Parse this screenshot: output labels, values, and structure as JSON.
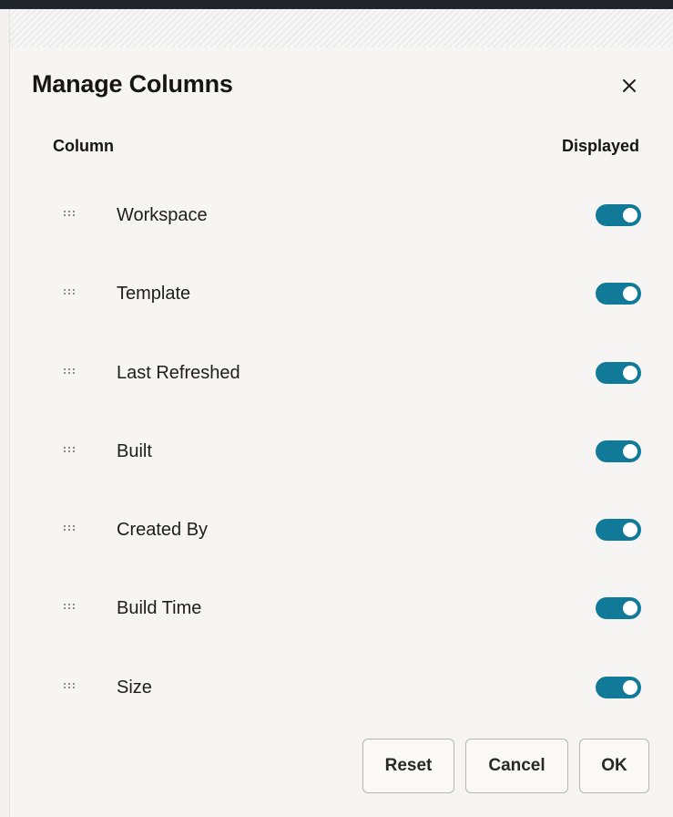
{
  "dialog": {
    "title": "Manage Columns",
    "close_icon": "close-icon"
  },
  "headers": {
    "column": "Column",
    "displayed": "Displayed"
  },
  "rows": [
    {
      "label": "Workspace",
      "displayed": true
    },
    {
      "label": "Template",
      "displayed": true
    },
    {
      "label": "Last Refreshed",
      "displayed": true
    },
    {
      "label": "Built",
      "displayed": true
    },
    {
      "label": "Created By",
      "displayed": true
    },
    {
      "label": "Build Time",
      "displayed": true
    },
    {
      "label": "Size",
      "displayed": true
    }
  ],
  "buttons": {
    "reset": "Reset",
    "cancel": "Cancel",
    "ok": "OK"
  },
  "colors": {
    "toggle_on": "#117a99",
    "background": "#f6f5f3",
    "text": "#161513"
  },
  "icons": {
    "drag_handle": "drag-handle-icon",
    "close": "close-icon"
  }
}
